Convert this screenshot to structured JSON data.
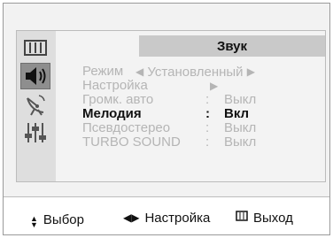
{
  "menu": {
    "title": "Звук",
    "sidebar_icons": [
      "picture-icon",
      "sound-icon",
      "channel-icon",
      "setup-icon"
    ],
    "items": [
      {
        "label": "Режим",
        "value": "Установленный",
        "type": "selector",
        "highlighted": false
      },
      {
        "label": "Настройка",
        "value": "",
        "type": "submenu",
        "highlighted": false
      },
      {
        "label": "Громк. авто",
        "value": "Выкл",
        "type": "option",
        "highlighted": false
      },
      {
        "label": "Мелодия",
        "value": "Вкл",
        "type": "option",
        "highlighted": true
      },
      {
        "label": "Псевдостерео",
        "value": "Выкл",
        "type": "option",
        "highlighted": false
      },
      {
        "label": "TURBO SOUND",
        "value": "Выкл",
        "type": "option",
        "highlighted": false
      }
    ]
  },
  "hints": {
    "select": "Выбор",
    "adjust": "Настройка",
    "exit": "Выход"
  },
  "colors": {
    "selected_icon_bg": "#8e8e8e",
    "title_bg": "#c9c9c9",
    "inactive_text": "#b5b5b5",
    "active_text": "#111111"
  }
}
